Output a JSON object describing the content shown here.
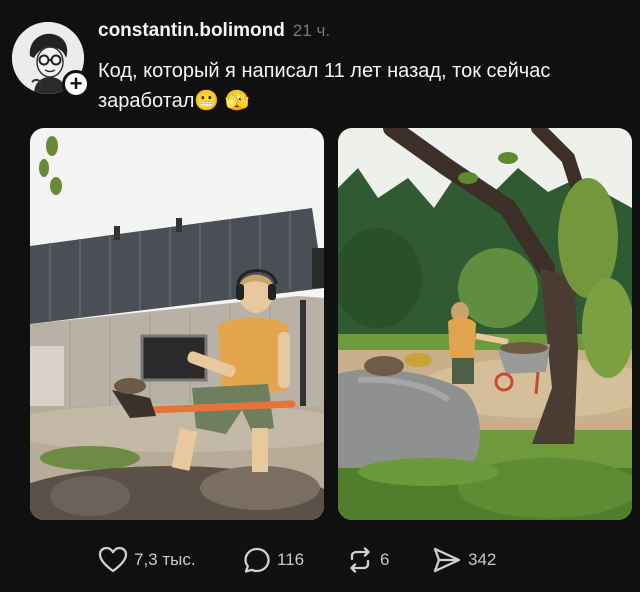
{
  "post": {
    "username": "constantin.bolimond",
    "timestamp": "21 ч.",
    "text": "Код, который я написал 11 лет назад, ток сейчас заработал",
    "emojis": [
      "😬",
      "🫣"
    ]
  },
  "icons": {
    "avatar": "avatar-sketch",
    "follow": "plus-icon",
    "like": "heart-icon",
    "reply": "comment-icon",
    "repost": "repost-icon",
    "share": "send-icon"
  },
  "actions": {
    "likes": "7,3 тыс.",
    "replies": "116",
    "reposts": "6",
    "shares": "342"
  },
  "colors": {
    "background": "#101010",
    "text": "#f3f5f7",
    "muted": "#777777"
  }
}
